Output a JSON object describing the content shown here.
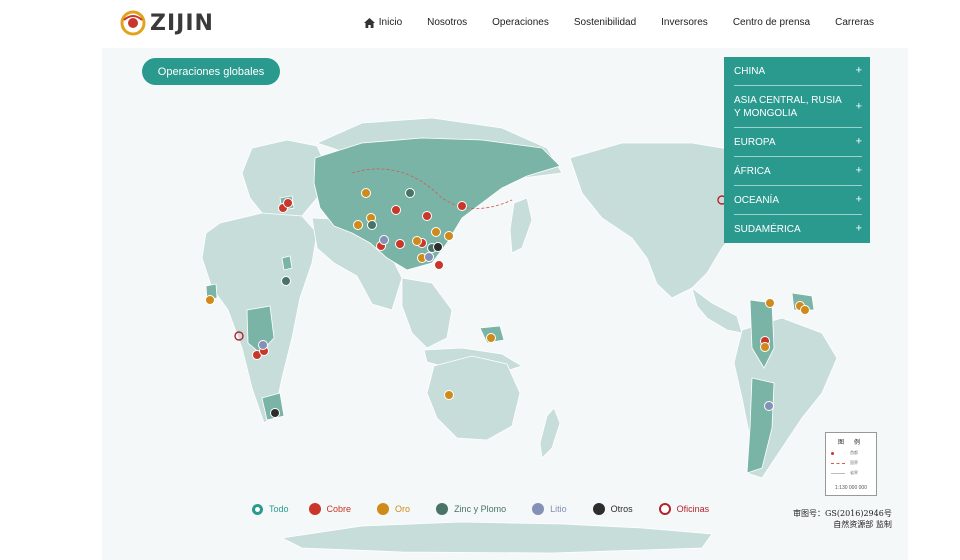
{
  "brand": {
    "name": "ZIJIN"
  },
  "nav": [
    {
      "label": "Inicio",
      "icon": "home-icon"
    },
    {
      "label": "Nosotros"
    },
    {
      "label": "Operaciones"
    },
    {
      "label": "Sostenibilidad"
    },
    {
      "label": "Inversores"
    },
    {
      "label": "Centro de prensa"
    },
    {
      "label": "Carreras"
    }
  ],
  "page": {
    "section_button": "Operaciones globales"
  },
  "regions": [
    {
      "label": "CHINA",
      "expand": "+"
    },
    {
      "label": "ASIA CENTRAL, RUSIA Y MONGOLIA",
      "expand": "+"
    },
    {
      "label": "EUROPA",
      "expand": "+"
    },
    {
      "label": "ÁFRICA",
      "expand": "+"
    },
    {
      "label": "OCEANÍA",
      "expand": "+"
    },
    {
      "label": "SUDAMÉRICA",
      "expand": "+"
    }
  ],
  "legend": [
    {
      "label": "Todo",
      "color": "#2a9a8e",
      "style": "ring-filled"
    },
    {
      "label": "Cobre",
      "color": "#c9362a",
      "style": "solid"
    },
    {
      "label": "Oro",
      "color": "#d08a1a",
      "style": "solid"
    },
    {
      "label": "Zinc y Plomo",
      "color": "#4a7367",
      "style": "solid"
    },
    {
      "label": "Litio",
      "color": "#8490b6",
      "style": "solid"
    },
    {
      "label": "Otros",
      "color": "#2d2d2d",
      "style": "solid"
    },
    {
      "label": "Oficinas",
      "color": "#b3232d",
      "style": "ring"
    }
  ],
  "map_legend": {
    "title": "图 例",
    "rows": [
      "首都",
      "国界",
      "省界"
    ],
    "scale": "1:130 000 000"
  },
  "map_approval": {
    "line1": "审图号：GS(2016)2946号",
    "line2": "自然资源部  监制"
  },
  "colors": {
    "accent": "#2a9a8e",
    "land": "#c7ddd9",
    "operating_land": "#7ab4a7",
    "ocean": "#f4f8f8"
  }
}
